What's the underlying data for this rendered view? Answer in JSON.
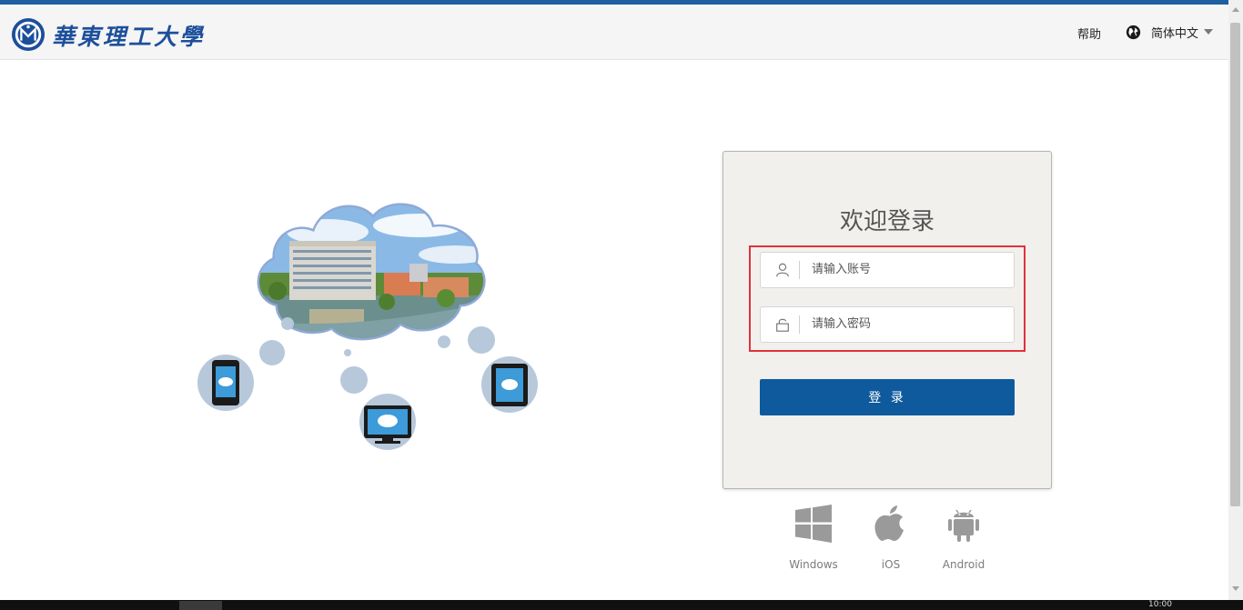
{
  "header": {
    "university_name": "華東理工大學",
    "help_label": "帮助",
    "language_label": "简体中文"
  },
  "login": {
    "title": "欢迎登录",
    "username_placeholder": "请输入账号",
    "password_placeholder": "请输入密码",
    "submit_label": "登 录"
  },
  "platforms": [
    {
      "label": "Windows",
      "icon": "windows-icon"
    },
    {
      "label": "iOS",
      "icon": "apple-icon"
    },
    {
      "label": "Android",
      "icon": "android-icon"
    }
  ],
  "taskbar": {
    "clock": "10:00"
  },
  "colors": {
    "brand_blue": "#1e5ea0",
    "login_button": "#0e5a9c",
    "highlight": "#e0323c",
    "card_bg": "#f1f0ed"
  }
}
